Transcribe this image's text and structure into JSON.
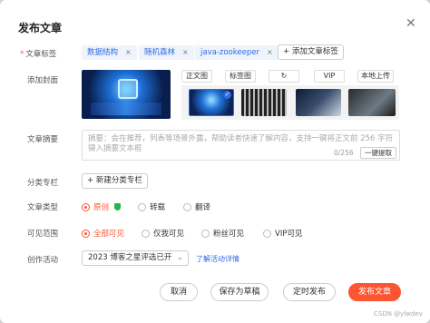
{
  "dialog": {
    "title": "发布文章",
    "close_icon": "close-icon"
  },
  "tags": {
    "label": "文章标签",
    "required_mark": "*",
    "items": [
      "数据结构",
      "随机森林",
      "java-zookeeper"
    ],
    "remove_glyph": "×",
    "add_label": "+ 添加文章标签"
  },
  "cover": {
    "label": "添加封面",
    "tools": [
      "正文图",
      "标签图",
      "↻",
      "VIP",
      "本地上传"
    ]
  },
  "summary": {
    "label": "文章摘要",
    "placeholder": "摘要：会在推荐，列表等场景外露，帮助读者快速了解内容，支持一键将正文前 256 字符键入摘要文本框",
    "counter": "0/256",
    "generate_label": "一键提取"
  },
  "category": {
    "label": "分类专栏",
    "add_label": "+ 新建分类专栏"
  },
  "article_type": {
    "label": "文章类型",
    "options": [
      "原创",
      "转载",
      "翻译"
    ],
    "selected": 0
  },
  "visibility": {
    "label": "可见范围",
    "options": [
      "全部可见",
      "仅我可见",
      "粉丝可见",
      "VIP可见"
    ],
    "selected": 0
  },
  "activity": {
    "label": "创作活动",
    "selected": "2023 博客之星评选已开",
    "link": "了解活动详情"
  },
  "footer": {
    "cancel": "取消",
    "draft": "保存为草稿",
    "schedule": "定时发布",
    "publish": "发布文章"
  },
  "watermark": "CSDN @ylwdev",
  "colors": {
    "accent": "#fc5531",
    "link": "#2d6be4",
    "tag_bg": "#eef3fc"
  }
}
